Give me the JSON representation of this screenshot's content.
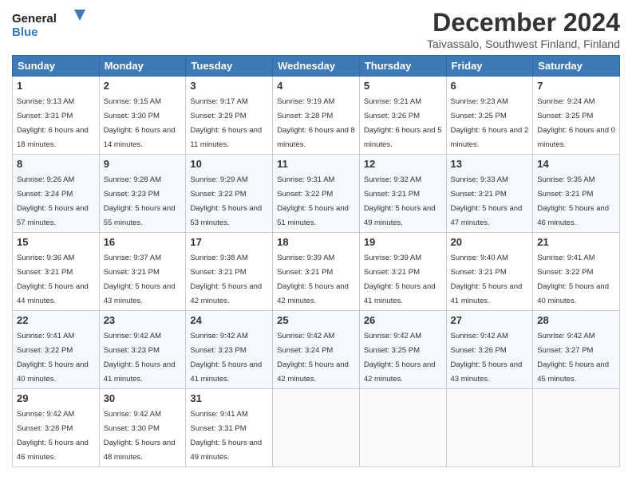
{
  "header": {
    "logo_line1": "General",
    "logo_line2": "Blue",
    "month_title": "December 2024",
    "subtitle": "Taivassalo, Southwest Finland, Finland"
  },
  "weekdays": [
    "Sunday",
    "Monday",
    "Tuesday",
    "Wednesday",
    "Thursday",
    "Friday",
    "Saturday"
  ],
  "weeks": [
    [
      {
        "day": "1",
        "sunrise": "9:13 AM",
        "sunset": "3:31 PM",
        "daylight": "6 hours and 18 minutes."
      },
      {
        "day": "2",
        "sunrise": "9:15 AM",
        "sunset": "3:30 PM",
        "daylight": "6 hours and 14 minutes."
      },
      {
        "day": "3",
        "sunrise": "9:17 AM",
        "sunset": "3:29 PM",
        "daylight": "6 hours and 11 minutes."
      },
      {
        "day": "4",
        "sunrise": "9:19 AM",
        "sunset": "3:28 PM",
        "daylight": "6 hours and 8 minutes."
      },
      {
        "day": "5",
        "sunrise": "9:21 AM",
        "sunset": "3:26 PM",
        "daylight": "6 hours and 5 minutes."
      },
      {
        "day": "6",
        "sunrise": "9:23 AM",
        "sunset": "3:25 PM",
        "daylight": "6 hours and 2 minutes."
      },
      {
        "day": "7",
        "sunrise": "9:24 AM",
        "sunset": "3:25 PM",
        "daylight": "6 hours and 0 minutes."
      }
    ],
    [
      {
        "day": "8",
        "sunrise": "9:26 AM",
        "sunset": "3:24 PM",
        "daylight": "5 hours and 57 minutes."
      },
      {
        "day": "9",
        "sunrise": "9:28 AM",
        "sunset": "3:23 PM",
        "daylight": "5 hours and 55 minutes."
      },
      {
        "day": "10",
        "sunrise": "9:29 AM",
        "sunset": "3:22 PM",
        "daylight": "5 hours and 53 minutes."
      },
      {
        "day": "11",
        "sunrise": "9:31 AM",
        "sunset": "3:22 PM",
        "daylight": "5 hours and 51 minutes."
      },
      {
        "day": "12",
        "sunrise": "9:32 AM",
        "sunset": "3:21 PM",
        "daylight": "5 hours and 49 minutes."
      },
      {
        "day": "13",
        "sunrise": "9:33 AM",
        "sunset": "3:21 PM",
        "daylight": "5 hours and 47 minutes."
      },
      {
        "day": "14",
        "sunrise": "9:35 AM",
        "sunset": "3:21 PM",
        "daylight": "5 hours and 46 minutes."
      }
    ],
    [
      {
        "day": "15",
        "sunrise": "9:36 AM",
        "sunset": "3:21 PM",
        "daylight": "5 hours and 44 minutes."
      },
      {
        "day": "16",
        "sunrise": "9:37 AM",
        "sunset": "3:21 PM",
        "daylight": "5 hours and 43 minutes."
      },
      {
        "day": "17",
        "sunrise": "9:38 AM",
        "sunset": "3:21 PM",
        "daylight": "5 hours and 42 minutes."
      },
      {
        "day": "18",
        "sunrise": "9:39 AM",
        "sunset": "3:21 PM",
        "daylight": "5 hours and 42 minutes."
      },
      {
        "day": "19",
        "sunrise": "9:39 AM",
        "sunset": "3:21 PM",
        "daylight": "5 hours and 41 minutes."
      },
      {
        "day": "20",
        "sunrise": "9:40 AM",
        "sunset": "3:21 PM",
        "daylight": "5 hours and 41 minutes."
      },
      {
        "day": "21",
        "sunrise": "9:41 AM",
        "sunset": "3:22 PM",
        "daylight": "5 hours and 40 minutes."
      }
    ],
    [
      {
        "day": "22",
        "sunrise": "9:41 AM",
        "sunset": "3:22 PM",
        "daylight": "5 hours and 40 minutes."
      },
      {
        "day": "23",
        "sunrise": "9:42 AM",
        "sunset": "3:23 PM",
        "daylight": "5 hours and 41 minutes."
      },
      {
        "day": "24",
        "sunrise": "9:42 AM",
        "sunset": "3:23 PM",
        "daylight": "5 hours and 41 minutes."
      },
      {
        "day": "25",
        "sunrise": "9:42 AM",
        "sunset": "3:24 PM",
        "daylight": "5 hours and 42 minutes."
      },
      {
        "day": "26",
        "sunrise": "9:42 AM",
        "sunset": "3:25 PM",
        "daylight": "5 hours and 42 minutes."
      },
      {
        "day": "27",
        "sunrise": "9:42 AM",
        "sunset": "3:26 PM",
        "daylight": "5 hours and 43 minutes."
      },
      {
        "day": "28",
        "sunrise": "9:42 AM",
        "sunset": "3:27 PM",
        "daylight": "5 hours and 45 minutes."
      }
    ],
    [
      {
        "day": "29",
        "sunrise": "9:42 AM",
        "sunset": "3:28 PM",
        "daylight": "5 hours and 46 minutes."
      },
      {
        "day": "30",
        "sunrise": "9:42 AM",
        "sunset": "3:30 PM",
        "daylight": "5 hours and 48 minutes."
      },
      {
        "day": "31",
        "sunrise": "9:41 AM",
        "sunset": "3:31 PM",
        "daylight": "5 hours and 49 minutes."
      },
      null,
      null,
      null,
      null
    ]
  ]
}
